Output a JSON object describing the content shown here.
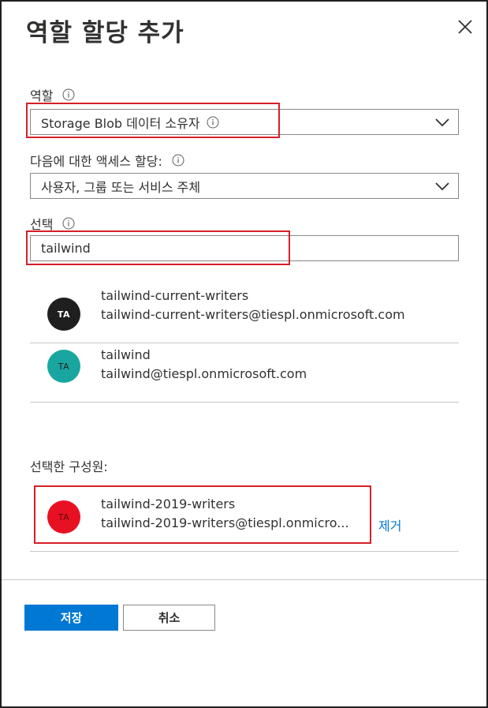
{
  "panel": {
    "title": "역할 할당 추가"
  },
  "role": {
    "label": "역할",
    "value": "Storage Blob 데이터 소유자"
  },
  "assign_access": {
    "label": "다음에 대한 액세스 할당:",
    "value": "사용자, 그룹 또는 서비스 주체"
  },
  "select": {
    "label": "선택",
    "value": "tailwind"
  },
  "results": [
    {
      "initials": "TA",
      "name": "tailwind-current-writers",
      "email": "tailwind-current-writers@tiespl.onmicrosoft.com",
      "avatar_color": "#1f1f1f"
    },
    {
      "initials": "TA",
      "name": "tailwind",
      "email": "tailwind@tiespl.onmicrosoft.com",
      "avatar_color": "#1aa6a0"
    }
  ],
  "selected_members": {
    "label": "선택한 구성원:",
    "items": [
      {
        "initials": "TA",
        "name": "tailwind-2019-writers",
        "email": "tailwind-2019-writers@tiespl.onmicro...",
        "avatar_color": "#e81123",
        "remove_label": "제거"
      }
    ]
  },
  "footer": {
    "save_label": "저장",
    "cancel_label": "취소"
  },
  "colors": {
    "accent": "#0078d4",
    "highlight": "#d62027"
  }
}
